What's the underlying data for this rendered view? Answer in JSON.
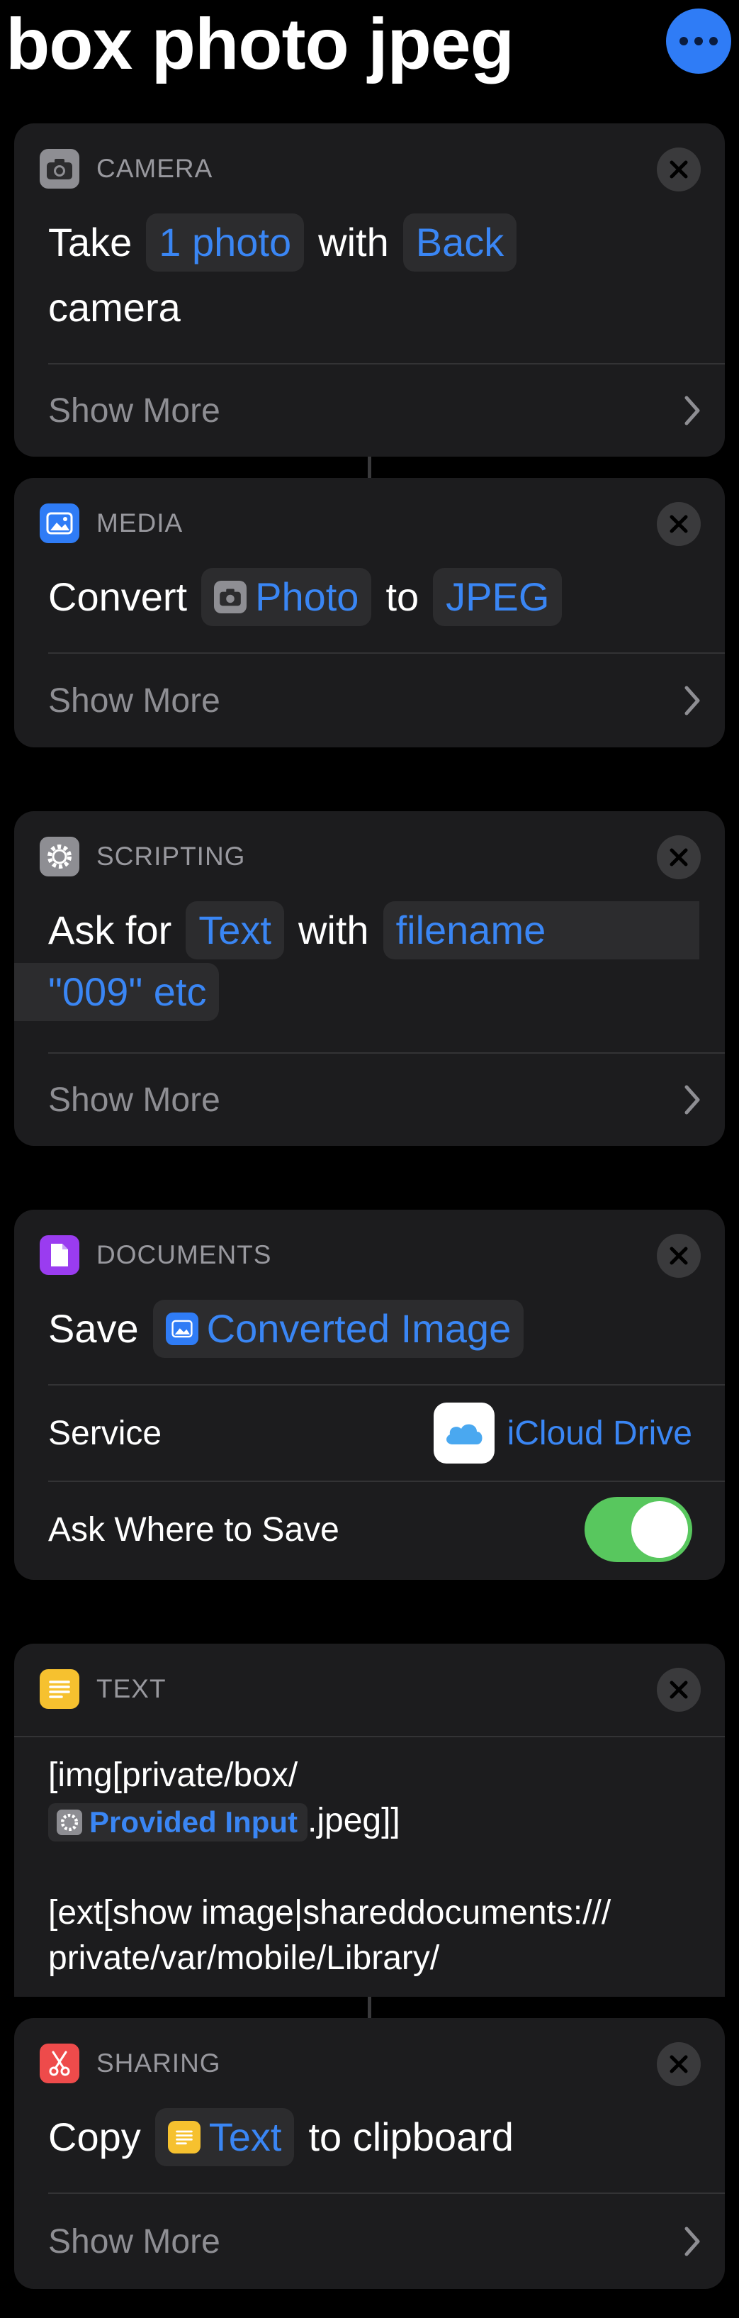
{
  "header": {
    "title": "box photo jpeg"
  },
  "icons": {
    "more": "ellipsis-icon",
    "close": "close-icon",
    "chevron": "chevron-right-icon"
  },
  "colors": {
    "accent": "#3a86f4",
    "card": "#1c1c1e",
    "toggle_on": "#58c75e"
  },
  "actions": [
    {
      "category": "CAMERA",
      "icon": "camera-icon",
      "line1": [
        "Take",
        "1 photo",
        "with",
        "Back"
      ],
      "line2": "camera",
      "show_more": "Show More"
    },
    {
      "category": "MEDIA",
      "icon": "photos-icon",
      "line1": [
        "Convert",
        "Photo",
        "to",
        "JPEG"
      ],
      "show_more": "Show More"
    },
    {
      "category": "SCRIPTING",
      "icon": "gear-icon",
      "line1": [
        "Ask for",
        "Text",
        "with",
        "filename"
      ],
      "line2": "\"009\" etc",
      "show_more": "Show More"
    },
    {
      "category": "DOCUMENTS",
      "icon": "document-icon",
      "line1": [
        "Save",
        "Converted Image"
      ],
      "service_label": "Service",
      "service_value": "iCloud Drive",
      "ask_label": "Ask Where to Save",
      "ask_value": true
    },
    {
      "category": "TEXT",
      "icon": "text-icon",
      "text_line1": "[img[private/box/",
      "variable": "Provided Input",
      "text_line2_suffix": ".jpeg]]",
      "text_line3": "[ext[show image|shareddocuments:///",
      "text_line4": "private/var/mobile/Library/"
    },
    {
      "category": "SHARING",
      "icon": "scissors-icon",
      "line1": [
        "Copy",
        "Text",
        "to clipboard"
      ],
      "show_more": "Show More"
    }
  ]
}
